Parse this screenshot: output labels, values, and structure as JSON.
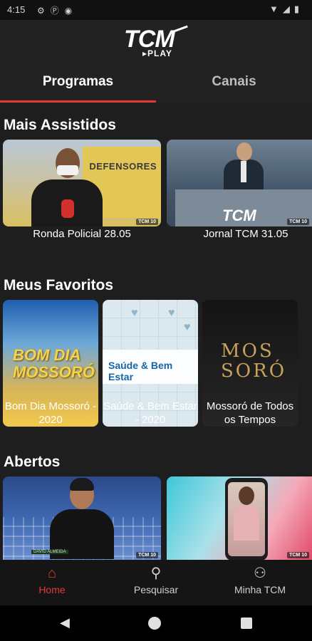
{
  "status_bar": {
    "time": "4:15",
    "left_icons": [
      "gear-icon",
      "p-icon",
      "record-icon"
    ],
    "right_icons": [
      "wifi-icon",
      "signal-icon",
      "battery-icon"
    ]
  },
  "header": {
    "logo_main": "TCM",
    "logo_sub": "PLAY"
  },
  "tabs": [
    {
      "label": "Programas",
      "active": true
    },
    {
      "label": "Canais",
      "active": false
    }
  ],
  "sections": {
    "mais_assistidos": {
      "title": "Mais Assistidos",
      "items": [
        {
          "label": "Ronda Policial 28.05",
          "thumb_text": "DEFENSORES",
          "badge": "TCM 10"
        },
        {
          "label": "Jornal TCM 31.05",
          "thumb_text": "TCM",
          "badge": "TCM 10"
        }
      ]
    },
    "meus_favoritos": {
      "title": "Meus Favoritos",
      "items": [
        {
          "label_line1": "Bom Dia Mossoró -",
          "label_line2": "2020",
          "thumb_text_1": "BOM DIA",
          "thumb_text_2": "MOSSORÓ"
        },
        {
          "label_line1": "Saúde & Bem Estar",
          "label_line2": "- 2020",
          "thumb_text": "Saúde & Bem Estar"
        },
        {
          "label_line1": "Mossoró de Todos",
          "label_line2": "os Tempos",
          "thumb_text_1": "MOS",
          "thumb_text_2": "SORÓ"
        }
      ]
    },
    "abertos": {
      "title": "Abertos",
      "items": [
        {
          "badge": "TCM 10",
          "caption": "DAVID ALMEIDA"
        },
        {
          "badge": "TCM 10"
        }
      ]
    }
  },
  "bottom_nav": [
    {
      "label": "Home",
      "icon": "home-icon",
      "active": true
    },
    {
      "label": "Pesquisar",
      "icon": "search-icon",
      "active": false
    },
    {
      "label": "Minha TCM",
      "icon": "user-icon",
      "active": false
    }
  ],
  "colors": {
    "accent": "#e53935",
    "background": "#1e1e1e",
    "nav_background": "#151515"
  }
}
